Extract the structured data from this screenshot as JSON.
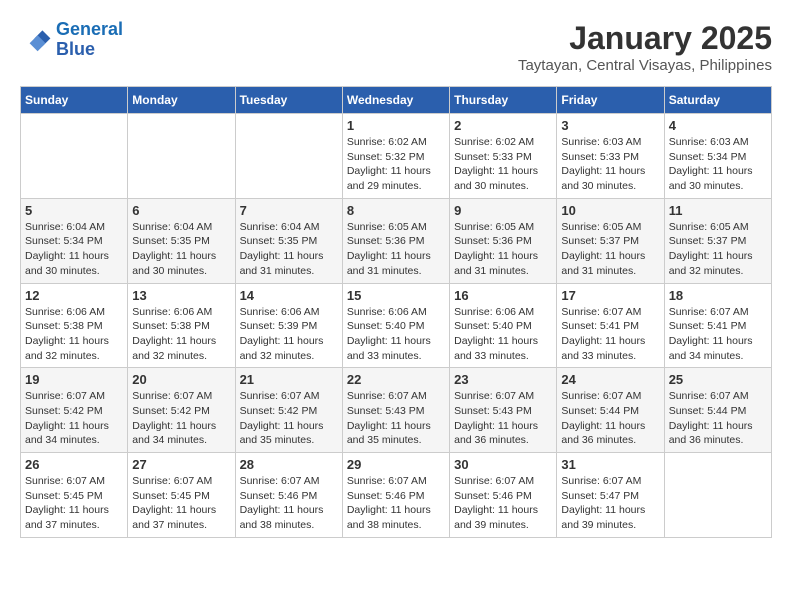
{
  "header": {
    "logo_line1": "General",
    "logo_line2": "Blue",
    "month": "January 2025",
    "location": "Taytayan, Central Visayas, Philippines"
  },
  "weekdays": [
    "Sunday",
    "Monday",
    "Tuesday",
    "Wednesday",
    "Thursday",
    "Friday",
    "Saturday"
  ],
  "weeks": [
    [
      {
        "day": "",
        "sunrise": "",
        "sunset": "",
        "daylight": ""
      },
      {
        "day": "",
        "sunrise": "",
        "sunset": "",
        "daylight": ""
      },
      {
        "day": "",
        "sunrise": "",
        "sunset": "",
        "daylight": ""
      },
      {
        "day": "1",
        "sunrise": "Sunrise: 6:02 AM",
        "sunset": "Sunset: 5:32 PM",
        "daylight": "Daylight: 11 hours and 29 minutes."
      },
      {
        "day": "2",
        "sunrise": "Sunrise: 6:02 AM",
        "sunset": "Sunset: 5:33 PM",
        "daylight": "Daylight: 11 hours and 30 minutes."
      },
      {
        "day": "3",
        "sunrise": "Sunrise: 6:03 AM",
        "sunset": "Sunset: 5:33 PM",
        "daylight": "Daylight: 11 hours and 30 minutes."
      },
      {
        "day": "4",
        "sunrise": "Sunrise: 6:03 AM",
        "sunset": "Sunset: 5:34 PM",
        "daylight": "Daylight: 11 hours and 30 minutes."
      }
    ],
    [
      {
        "day": "5",
        "sunrise": "Sunrise: 6:04 AM",
        "sunset": "Sunset: 5:34 PM",
        "daylight": "Daylight: 11 hours and 30 minutes."
      },
      {
        "day": "6",
        "sunrise": "Sunrise: 6:04 AM",
        "sunset": "Sunset: 5:35 PM",
        "daylight": "Daylight: 11 hours and 30 minutes."
      },
      {
        "day": "7",
        "sunrise": "Sunrise: 6:04 AM",
        "sunset": "Sunset: 5:35 PM",
        "daylight": "Daylight: 11 hours and 31 minutes."
      },
      {
        "day": "8",
        "sunrise": "Sunrise: 6:05 AM",
        "sunset": "Sunset: 5:36 PM",
        "daylight": "Daylight: 11 hours and 31 minutes."
      },
      {
        "day": "9",
        "sunrise": "Sunrise: 6:05 AM",
        "sunset": "Sunset: 5:36 PM",
        "daylight": "Daylight: 11 hours and 31 minutes."
      },
      {
        "day": "10",
        "sunrise": "Sunrise: 6:05 AM",
        "sunset": "Sunset: 5:37 PM",
        "daylight": "Daylight: 11 hours and 31 minutes."
      },
      {
        "day": "11",
        "sunrise": "Sunrise: 6:05 AM",
        "sunset": "Sunset: 5:37 PM",
        "daylight": "Daylight: 11 hours and 32 minutes."
      }
    ],
    [
      {
        "day": "12",
        "sunrise": "Sunrise: 6:06 AM",
        "sunset": "Sunset: 5:38 PM",
        "daylight": "Daylight: 11 hours and 32 minutes."
      },
      {
        "day": "13",
        "sunrise": "Sunrise: 6:06 AM",
        "sunset": "Sunset: 5:38 PM",
        "daylight": "Daylight: 11 hours and 32 minutes."
      },
      {
        "day": "14",
        "sunrise": "Sunrise: 6:06 AM",
        "sunset": "Sunset: 5:39 PM",
        "daylight": "Daylight: 11 hours and 32 minutes."
      },
      {
        "day": "15",
        "sunrise": "Sunrise: 6:06 AM",
        "sunset": "Sunset: 5:40 PM",
        "daylight": "Daylight: 11 hours and 33 minutes."
      },
      {
        "day": "16",
        "sunrise": "Sunrise: 6:06 AM",
        "sunset": "Sunset: 5:40 PM",
        "daylight": "Daylight: 11 hours and 33 minutes."
      },
      {
        "day": "17",
        "sunrise": "Sunrise: 6:07 AM",
        "sunset": "Sunset: 5:41 PM",
        "daylight": "Daylight: 11 hours and 33 minutes."
      },
      {
        "day": "18",
        "sunrise": "Sunrise: 6:07 AM",
        "sunset": "Sunset: 5:41 PM",
        "daylight": "Daylight: 11 hours and 34 minutes."
      }
    ],
    [
      {
        "day": "19",
        "sunrise": "Sunrise: 6:07 AM",
        "sunset": "Sunset: 5:42 PM",
        "daylight": "Daylight: 11 hours and 34 minutes."
      },
      {
        "day": "20",
        "sunrise": "Sunrise: 6:07 AM",
        "sunset": "Sunset: 5:42 PM",
        "daylight": "Daylight: 11 hours and 34 minutes."
      },
      {
        "day": "21",
        "sunrise": "Sunrise: 6:07 AM",
        "sunset": "Sunset: 5:42 PM",
        "daylight": "Daylight: 11 hours and 35 minutes."
      },
      {
        "day": "22",
        "sunrise": "Sunrise: 6:07 AM",
        "sunset": "Sunset: 5:43 PM",
        "daylight": "Daylight: 11 hours and 35 minutes."
      },
      {
        "day": "23",
        "sunrise": "Sunrise: 6:07 AM",
        "sunset": "Sunset: 5:43 PM",
        "daylight": "Daylight: 11 hours and 36 minutes."
      },
      {
        "day": "24",
        "sunrise": "Sunrise: 6:07 AM",
        "sunset": "Sunset: 5:44 PM",
        "daylight": "Daylight: 11 hours and 36 minutes."
      },
      {
        "day": "25",
        "sunrise": "Sunrise: 6:07 AM",
        "sunset": "Sunset: 5:44 PM",
        "daylight": "Daylight: 11 hours and 36 minutes."
      }
    ],
    [
      {
        "day": "26",
        "sunrise": "Sunrise: 6:07 AM",
        "sunset": "Sunset: 5:45 PM",
        "daylight": "Daylight: 11 hours and 37 minutes."
      },
      {
        "day": "27",
        "sunrise": "Sunrise: 6:07 AM",
        "sunset": "Sunset: 5:45 PM",
        "daylight": "Daylight: 11 hours and 37 minutes."
      },
      {
        "day": "28",
        "sunrise": "Sunrise: 6:07 AM",
        "sunset": "Sunset: 5:46 PM",
        "daylight": "Daylight: 11 hours and 38 minutes."
      },
      {
        "day": "29",
        "sunrise": "Sunrise: 6:07 AM",
        "sunset": "Sunset: 5:46 PM",
        "daylight": "Daylight: 11 hours and 38 minutes."
      },
      {
        "day": "30",
        "sunrise": "Sunrise: 6:07 AM",
        "sunset": "Sunset: 5:46 PM",
        "daylight": "Daylight: 11 hours and 39 minutes."
      },
      {
        "day": "31",
        "sunrise": "Sunrise: 6:07 AM",
        "sunset": "Sunset: 5:47 PM",
        "daylight": "Daylight: 11 hours and 39 minutes."
      },
      {
        "day": "",
        "sunrise": "",
        "sunset": "",
        "daylight": ""
      }
    ]
  ]
}
